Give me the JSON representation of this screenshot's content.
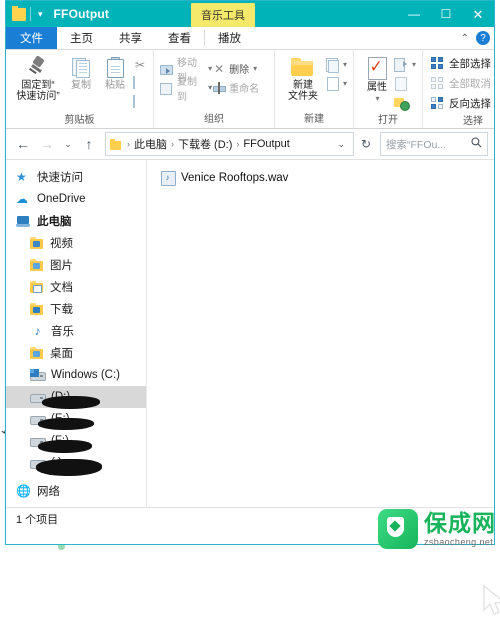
{
  "window": {
    "title": "FFOutput",
    "quick_access_caret": "▾",
    "contextual_tab": "音乐工具",
    "minimize": "—",
    "maximize": "☐",
    "close": "✕"
  },
  "ribbon": {
    "tabs": [
      {
        "label": "文件",
        "active": true
      },
      {
        "label": "主页",
        "active": false
      },
      {
        "label": "共享",
        "active": false
      },
      {
        "label": "查看",
        "active": false
      },
      {
        "label": "播放",
        "active": false
      }
    ],
    "collapse_caret": "⌃",
    "help_label": "?",
    "groups": [
      {
        "title": "剪贴板",
        "big_buttons": [
          {
            "label": "固定到“\n快速访问”",
            "line1": "固定到“",
            "line2": "快速访问”",
            "icon": "pin-icon"
          },
          {
            "label": "复制",
            "icon": "copy-icon"
          },
          {
            "label": "粘贴",
            "icon": "paste-icon"
          }
        ],
        "small_buttons": [
          {
            "label": "",
            "icon": "scissors-icon"
          },
          {
            "label": "",
            "icon": "copy-path-icon"
          },
          {
            "label": "",
            "icon": "paste-shortcut-icon"
          }
        ]
      },
      {
        "title": "组织",
        "small_buttons": [
          {
            "label": "移动到",
            "icon": "move-to-icon",
            "caret": "▾",
            "disabled": true
          },
          {
            "label": "删除",
            "icon": "delete-x-icon",
            "caret": "▾",
            "disabled": false
          },
          {
            "label": "复制到",
            "icon": "copy-to-icon",
            "caret": "▾",
            "disabled": true
          },
          {
            "label": "重命名",
            "icon": "rename-icon",
            "caret": "",
            "disabled": true
          }
        ]
      },
      {
        "title": "新建",
        "big_buttons": [
          {
            "line1": "新建",
            "line2": "文件夹",
            "icon": "new-folder-icon"
          }
        ],
        "small_buttons": [
          {
            "label": "",
            "icon": "new-item-icon",
            "caret": "▾"
          },
          {
            "label": "",
            "icon": "easy-access-icon",
            "caret": "▾"
          }
        ]
      },
      {
        "title": "打开",
        "big_buttons": [
          {
            "line1": "属性",
            "line2": "▾",
            "icon": "properties-icon"
          }
        ],
        "small_buttons": [
          {
            "label": "",
            "icon": "open-with-icon",
            "caret": "▾"
          },
          {
            "label": "",
            "icon": "edit-icon",
            "caret": ""
          },
          {
            "label": "",
            "icon": "history-icon",
            "caret": ""
          }
        ]
      },
      {
        "title": "选择",
        "select_buttons": [
          {
            "label": "全部选择",
            "icon": "select-all-icon",
            "disabled": false
          },
          {
            "label": "全部取消",
            "icon": "select-none-icon",
            "disabled": true
          },
          {
            "label": "反向选择",
            "icon": "invert-selection-icon",
            "disabled": false
          }
        ]
      }
    ]
  },
  "address": {
    "back": "←",
    "forward": "→",
    "recent": "⌄",
    "up": "↑",
    "breadcrumbs": [
      "此电脑",
      "下载卷 (D:)",
      "FFOutput"
    ],
    "separator": "›",
    "dropdown_caret": "⌄",
    "refresh": "↻",
    "search_placeholder": "搜索“FFOu...",
    "search_icon": "🔍"
  },
  "sidebar": {
    "items": [
      {
        "label": "快速访问",
        "icon": "star-icon",
        "level": 1,
        "selected": false
      },
      {
        "label": "OneDrive",
        "icon": "cloud-icon",
        "level": 1,
        "selected": false
      },
      {
        "label": "此电脑",
        "icon": "this-pc-icon",
        "level": 1,
        "selected": false
      },
      {
        "label": "视频",
        "icon": "videos-folder-icon",
        "level": 2,
        "selected": false
      },
      {
        "label": "图片",
        "icon": "pictures-folder-icon",
        "level": 2,
        "selected": false
      },
      {
        "label": "文档",
        "icon": "documents-folder-icon",
        "level": 2,
        "selected": false
      },
      {
        "label": "下载",
        "icon": "downloads-folder-icon",
        "level": 2,
        "selected": false
      },
      {
        "label": "音乐",
        "icon": "music-folder-icon",
        "level": 2,
        "selected": false
      },
      {
        "label": "桌面",
        "icon": "desktop-folder-icon",
        "level": 2,
        "selected": false
      },
      {
        "label": "Windows (C:)",
        "icon": "windows-drive-icon",
        "level": 2,
        "selected": false
      },
      {
        "label": "(D:)",
        "icon": "drive-icon",
        "level": 2,
        "selected": true,
        "redacted": true
      },
      {
        "label": "(E:)",
        "icon": "drive-icon",
        "level": 2,
        "selected": false,
        "redacted": true
      },
      {
        "label": "(F:)",
        "icon": "drive-icon",
        "level": 2,
        "selected": false,
        "redacted": true
      },
      {
        "label": "(:)",
        "icon": "drive-icon",
        "level": 2,
        "selected": false,
        "redacted": true
      },
      {
        "label": "网络",
        "icon": "network-icon",
        "level": 1,
        "selected": false
      }
    ]
  },
  "files": {
    "items": [
      {
        "name": "Venice Rooftops.wav",
        "icon": "wav-file-icon"
      }
    ]
  },
  "status": {
    "item_count_text": "1 个项目"
  },
  "watermark": {
    "name_cn": "保成网",
    "name_en": "zsbaocheng.net"
  },
  "colors": {
    "titlebar": "#00b3b8",
    "contextual_tab": "#f5e96b",
    "file_tab": "#1a7fd4",
    "selection": "#d8d8d8",
    "watermark_green": "#18b45c"
  }
}
